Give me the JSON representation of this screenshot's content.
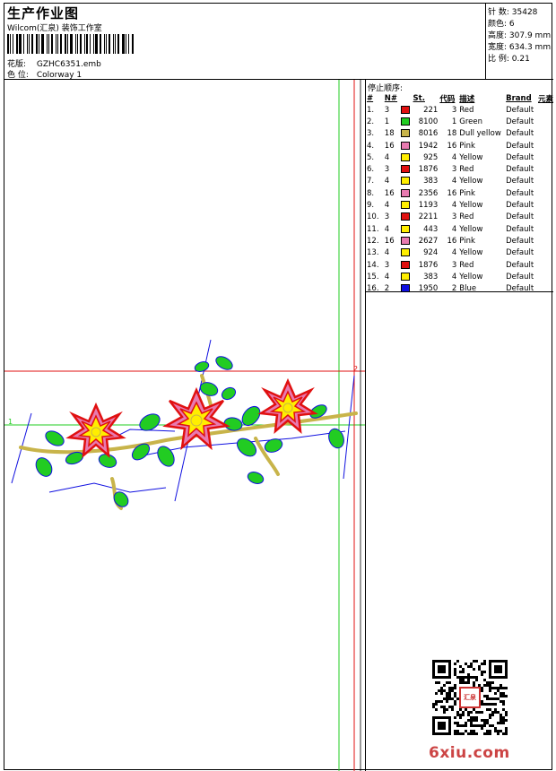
{
  "header": {
    "title": "生产作业图",
    "studio": "Wilcom(汇泉) 装饰工作室",
    "design_label": "花版:",
    "design_file": "GZHC6351.emb",
    "colorway_label": "色 位:",
    "colorway": "Colorway 1"
  },
  "stats": [
    {
      "label": "针 数:",
      "value": "35428"
    },
    {
      "label": "颜色:",
      "value": "6"
    },
    {
      "label": "高度:",
      "value": "307.9 mm"
    },
    {
      "label": "宽度:",
      "value": "634.3 mm"
    },
    {
      "label": "比 例:",
      "value": "0.21"
    }
  ],
  "stop_sequence": {
    "title": "停止顺序:",
    "headers": {
      "idx": "#",
      "no": "N#",
      "st": "St.",
      "code": "代码",
      "desc": "描述",
      "brand": "Brand",
      "elem": "元素"
    },
    "rows": [
      {
        "idx": "1.",
        "no": "3",
        "color": "#e01010",
        "st": "221",
        "code": "3",
        "desc": "Red",
        "brand": "Default"
      },
      {
        "idx": "2.",
        "no": "1",
        "color": "#22cc22",
        "st": "8100",
        "code": "1",
        "desc": "Green",
        "brand": "Default"
      },
      {
        "idx": "3.",
        "no": "18",
        "color": "#c8b44a",
        "st": "8016",
        "code": "18",
        "desc": "Dull yellow",
        "brand": "Default"
      },
      {
        "idx": "4.",
        "no": "16",
        "color": "#e87ab0",
        "st": "1942",
        "code": "16",
        "desc": "Pink",
        "brand": "Default"
      },
      {
        "idx": "5.",
        "no": "4",
        "color": "#ffee00",
        "st": "925",
        "code": "4",
        "desc": "Yellow",
        "brand": "Default"
      },
      {
        "idx": "6.",
        "no": "3",
        "color": "#e01010",
        "st": "1876",
        "code": "3",
        "desc": "Red",
        "brand": "Default"
      },
      {
        "idx": "7.",
        "no": "4",
        "color": "#ffee00",
        "st": "383",
        "code": "4",
        "desc": "Yellow",
        "brand": "Default"
      },
      {
        "idx": "8.",
        "no": "16",
        "color": "#e87ab0",
        "st": "2356",
        "code": "16",
        "desc": "Pink",
        "brand": "Default"
      },
      {
        "idx": "9.",
        "no": "4",
        "color": "#ffee00",
        "st": "1193",
        "code": "4",
        "desc": "Yellow",
        "brand": "Default"
      },
      {
        "idx": "10.",
        "no": "3",
        "color": "#e01010",
        "st": "2211",
        "code": "3",
        "desc": "Red",
        "brand": "Default"
      },
      {
        "idx": "11.",
        "no": "4",
        "color": "#ffee00",
        "st": "443",
        "code": "4",
        "desc": "Yellow",
        "brand": "Default"
      },
      {
        "idx": "12.",
        "no": "16",
        "color": "#e87ab0",
        "st": "2627",
        "code": "16",
        "desc": "Pink",
        "brand": "Default"
      },
      {
        "idx": "13.",
        "no": "4",
        "color": "#ffee00",
        "st": "924",
        "code": "4",
        "desc": "Yellow",
        "brand": "Default"
      },
      {
        "idx": "14.",
        "no": "3",
        "color": "#e01010",
        "st": "1876",
        "code": "3",
        "desc": "Red",
        "brand": "Default"
      },
      {
        "idx": "15.",
        "no": "4",
        "color": "#ffee00",
        "st": "383",
        "code": "4",
        "desc": "Yellow",
        "brand": "Default"
      },
      {
        "idx": "16.",
        "no": "2",
        "color": "#1010e0",
        "st": "1950",
        "code": "2",
        "desc": "Blue",
        "brand": "Default"
      }
    ]
  },
  "markers": {
    "origin": "1",
    "end": "2"
  },
  "qr_badge": "汇泉",
  "watermark": "6xiu.com"
}
